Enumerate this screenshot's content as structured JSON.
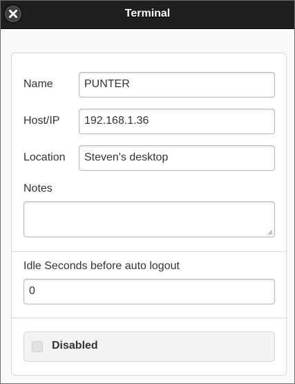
{
  "window": {
    "title": "Terminal",
    "close_icon": "close-icon"
  },
  "form": {
    "name": {
      "label": "Name",
      "value": "PUNTER"
    },
    "host": {
      "label": "Host/IP",
      "value": "192.168.1.36"
    },
    "location": {
      "label": "Location",
      "value": "Steven's desktop"
    },
    "notes": {
      "label": "Notes",
      "value": ""
    },
    "idle": {
      "label": "Idle Seconds before auto logout",
      "value": "0"
    },
    "disabled": {
      "label": "Disabled",
      "checked": false
    }
  },
  "colors": {
    "titlebar": "#1f1f1f",
    "title_text": "#ffffff",
    "card_background": "#ffffff",
    "text": "#333333"
  }
}
